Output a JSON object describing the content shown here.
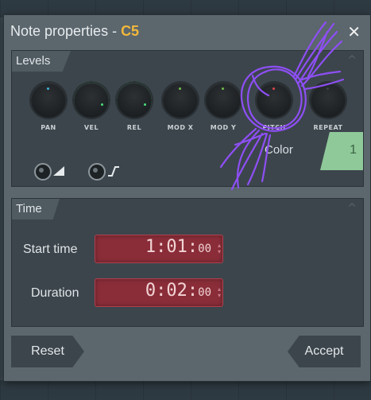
{
  "dialog": {
    "title_prefix": "Note properties - ",
    "title_note": "C5",
    "close_label": "✕"
  },
  "levels": {
    "label": "Levels",
    "collapse_icon": "^",
    "knobs": [
      {
        "label": "PAN",
        "accent": "#3fb4d8"
      },
      {
        "label": "VEL",
        "accent": "#46e07a",
        "ring": true
      },
      {
        "label": "REL",
        "accent": "#46e07a",
        "ring": true
      },
      {
        "label": "MOD X",
        "accent": "#6fbf4a"
      },
      {
        "label": "MOD Y",
        "accent": "#6fbf4a"
      },
      {
        "label": "PITCH",
        "accent": "#e0454a"
      },
      {
        "label": "REPEAT",
        "accent": "#3a4248"
      }
    ],
    "color_label": "Color",
    "color_value": "1",
    "color_swatch": "#8fc99a"
  },
  "time": {
    "label": "Time",
    "collapse_icon": "^",
    "start_label": "Start time",
    "start_main": "1:01:",
    "start_ticks": "00",
    "duration_label": "Duration",
    "duration_main": "0:02:",
    "duration_ticks": "00"
  },
  "buttons": {
    "reset": "Reset",
    "accept": "Accept"
  },
  "colors": {
    "note_accent": "#f2b83a",
    "time_bg": "#8a2d39",
    "annotation": "#8e4ff5"
  }
}
